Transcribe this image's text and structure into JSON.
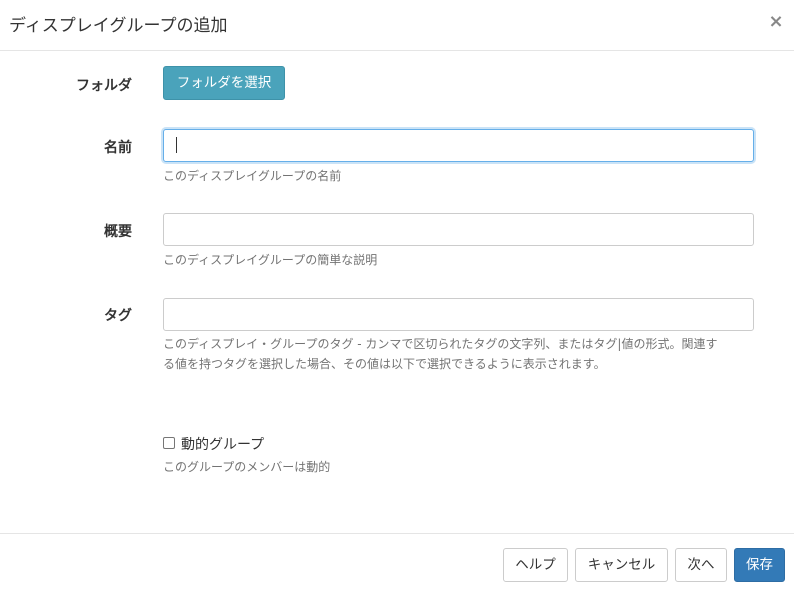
{
  "dialog": {
    "title": "ディスプレイグループの追加",
    "close_symbol": "×"
  },
  "form": {
    "folder": {
      "label": "フォルダ",
      "button": "フォルダを選択"
    },
    "name": {
      "label": "名前",
      "value": "",
      "help": "このディスプレイグループの名前"
    },
    "description": {
      "label": "概要",
      "value": "",
      "help": "このディスプレイグループの簡単な説明"
    },
    "tags": {
      "label": "タグ",
      "value": "",
      "help_line1": "このディスプレイ・グループのタグ - カンマで区切られたタグの文字列、またはタグ|値の形式。関連す",
      "help_line2": "る値を持つタグを選択した場合、その値は以下で選択できるように表示されます。"
    },
    "dynamic": {
      "label": "動的グループ",
      "checked": false,
      "help": "このグループのメンバーは動的"
    }
  },
  "footer": {
    "help": "ヘルプ",
    "cancel": "キャンセル",
    "next": "次へ",
    "save": "保存"
  },
  "colors": {
    "folder_button": "#4aa3bb",
    "save_button": "#337ab7",
    "focus_border": "#66afe9"
  }
}
